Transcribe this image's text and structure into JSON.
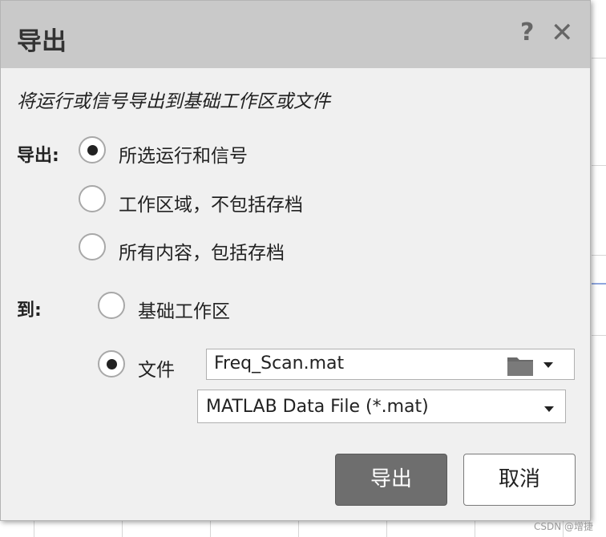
{
  "dialog": {
    "title": "导出",
    "help_icon": "?",
    "close_icon": "✕",
    "description": "将运行或信号导出到基础工作区或文件"
  },
  "export": {
    "label": "导出:",
    "options": [
      {
        "label": "所选运行和信号",
        "selected": true
      },
      {
        "label": "工作区域，不包括存档",
        "selected": false
      },
      {
        "label": "所有内容，包括存档",
        "selected": false
      }
    ]
  },
  "destination": {
    "label": "到:",
    "options": [
      {
        "label": "基础工作区",
        "selected": false
      },
      {
        "label": "文件",
        "selected": true
      }
    ],
    "file_name": "Freq_Scan.mat",
    "file_type": "MATLAB Data File (*.mat)"
  },
  "buttons": {
    "export": "导出",
    "cancel": "取消"
  },
  "watermark": "CSDN @增捷",
  "colors": {
    "titlebar": "#c9c9c9",
    "dialog_bg": "#f0f0f0",
    "primary_button": "#6e6e6e"
  }
}
